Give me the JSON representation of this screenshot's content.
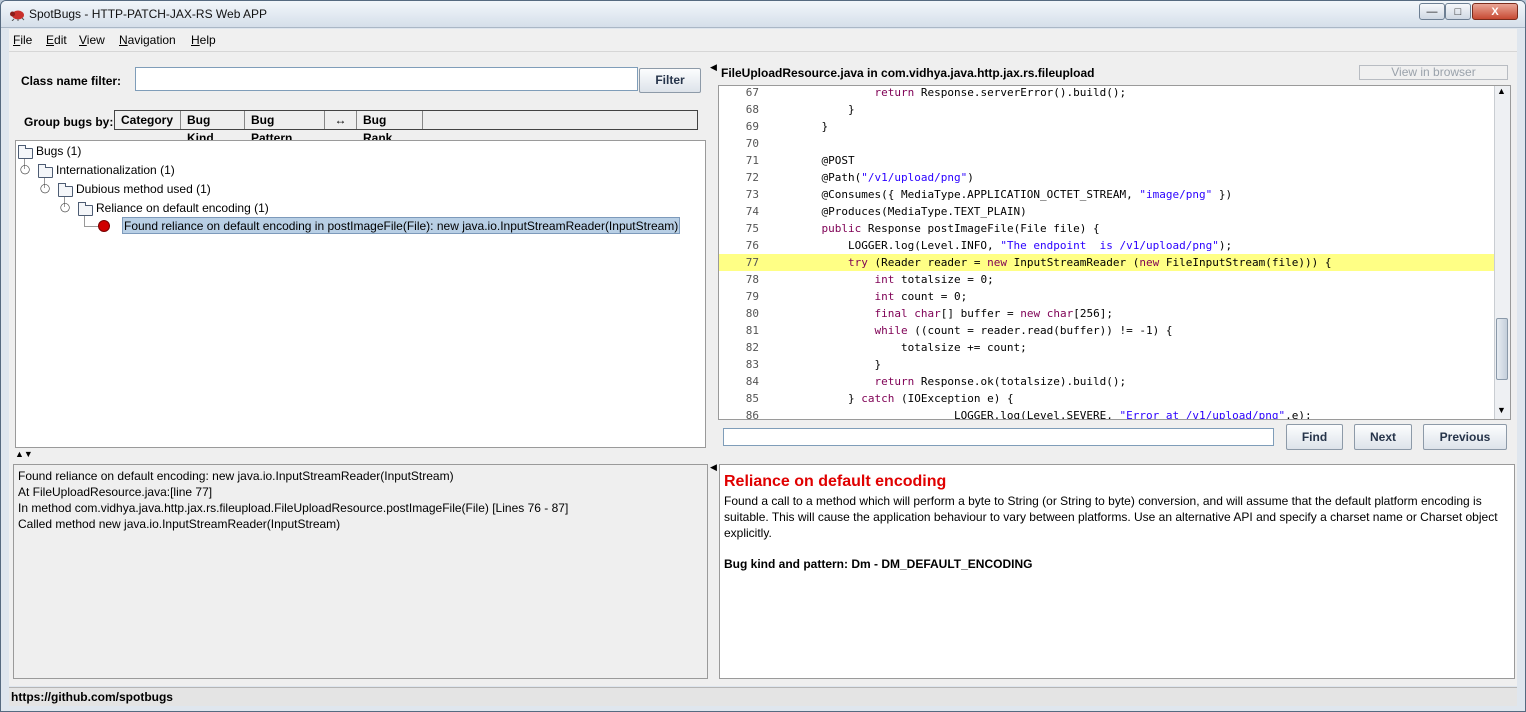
{
  "window": {
    "title": "SpotBugs - HTTP-PATCH-JAX-RS Web APP",
    "controls": {
      "minimize": "—",
      "maximize": "□",
      "close": "X"
    }
  },
  "menu": [
    {
      "first": "F",
      "rest": "ile"
    },
    {
      "first": "E",
      "rest": "dit"
    },
    {
      "first": "V",
      "rest": "iew"
    },
    {
      "first": "N",
      "rest": "avigation"
    },
    {
      "first": "H",
      "rest": "elp"
    }
  ],
  "filter": {
    "label": "Class name filter:",
    "value": "",
    "button": "Filter"
  },
  "group_by": {
    "label": "Group bugs by:",
    "options": [
      "Category",
      "Bug Kind",
      "Bug Pattern",
      "↔",
      "Bug Rank"
    ]
  },
  "tree": [
    {
      "label": "Bugs (1)"
    },
    {
      "label": "Internationalization (1)"
    },
    {
      "label": "Dubious method used (1)"
    },
    {
      "label": "Reliance on default encoding (1)"
    },
    {
      "label": "Found reliance on default encoding in postImageFile(File): new java.io.InputStreamReader(InputStream)"
    }
  ],
  "source": {
    "header": "FileUploadResource.java in com.vidhya.java.http.jax.rs.fileupload",
    "view_in_browser": "View in browser",
    "highlight_line": "77",
    "lines": [
      {
        "n": "67",
        "segs": [
          {
            "t": "            "
          },
          {
            "t": "return",
            "c": "kw"
          },
          {
            "t": " Response.serverError().build();"
          }
        ]
      },
      {
        "n": "68",
        "segs": [
          {
            "t": "        }"
          }
        ]
      },
      {
        "n": "69",
        "segs": [
          {
            "t": "    }"
          }
        ]
      },
      {
        "n": "70",
        "segs": [
          {
            "t": ""
          }
        ]
      },
      {
        "n": "71",
        "segs": [
          {
            "t": "    @POST"
          }
        ]
      },
      {
        "n": "72",
        "segs": [
          {
            "t": "    @Path("
          },
          {
            "t": "\"/v1/upload/png\"",
            "c": "st"
          },
          {
            "t": ")"
          }
        ]
      },
      {
        "n": "73",
        "segs": [
          {
            "t": "    @Consumes({ MediaType.APPLICATION_OCTET_STREAM, "
          },
          {
            "t": "\"image/png\"",
            "c": "st"
          },
          {
            "t": " })"
          }
        ]
      },
      {
        "n": "74",
        "segs": [
          {
            "t": "    @Produces(MediaType.TEXT_PLAIN)"
          }
        ]
      },
      {
        "n": "75",
        "segs": [
          {
            "t": "    "
          },
          {
            "t": "public",
            "c": "kw"
          },
          {
            "t": " Response postImageFile(File file) {"
          }
        ]
      },
      {
        "n": "76",
        "segs": [
          {
            "t": "        LOGGER.log(Level.INFO, "
          },
          {
            "t": "\"The endpoint  is /v1/upload/png\"",
            "c": "st"
          },
          {
            "t": ");"
          }
        ]
      },
      {
        "n": "77",
        "segs": [
          {
            "t": "        "
          },
          {
            "t": "try",
            "c": "kw"
          },
          {
            "t": " (Reader reader = "
          },
          {
            "t": "new",
            "c": "kw"
          },
          {
            "t": " InputStreamReader ("
          },
          {
            "t": "new",
            "c": "kw"
          },
          {
            "t": " FileInputStream(file))) {"
          }
        ]
      },
      {
        "n": "78",
        "segs": [
          {
            "t": "            "
          },
          {
            "t": "int",
            "c": "kw"
          },
          {
            "t": " totalsize = 0;"
          }
        ]
      },
      {
        "n": "79",
        "segs": [
          {
            "t": "            "
          },
          {
            "t": "int",
            "c": "kw"
          },
          {
            "t": " count = 0;"
          }
        ]
      },
      {
        "n": "80",
        "segs": [
          {
            "t": "            "
          },
          {
            "t": "final",
            "c": "kw"
          },
          {
            "t": " "
          },
          {
            "t": "char",
            "c": "kw"
          },
          {
            "t": "[] buffer = "
          },
          {
            "t": "new",
            "c": "kw"
          },
          {
            "t": " "
          },
          {
            "t": "char",
            "c": "kw"
          },
          {
            "t": "[256];"
          }
        ]
      },
      {
        "n": "81",
        "segs": [
          {
            "t": "            "
          },
          {
            "t": "while",
            "c": "kw"
          },
          {
            "t": " ((count = reader.read(buffer)) != -1) {"
          }
        ]
      },
      {
        "n": "82",
        "segs": [
          {
            "t": "                totalsize += count;"
          }
        ]
      },
      {
        "n": "83",
        "segs": [
          {
            "t": "            }"
          }
        ]
      },
      {
        "n": "84",
        "segs": [
          {
            "t": "            "
          },
          {
            "t": "return",
            "c": "kw"
          },
          {
            "t": " Response.ok(totalsize).build();"
          }
        ]
      },
      {
        "n": "85",
        "segs": [
          {
            "t": "        } "
          },
          {
            "t": "catch",
            "c": "kw"
          },
          {
            "t": " (IOException e) {"
          }
        ]
      },
      {
        "n": "86",
        "segs": [
          {
            "t": "                        LOGGER.log(Level.SEVERE, "
          },
          {
            "t": "\"Error at /v1/upload/png\"",
            "c": "st"
          },
          {
            "t": ",e);"
          }
        ]
      }
    ]
  },
  "find": {
    "value": "",
    "find": "Find",
    "next": "Next",
    "previous": "Previous"
  },
  "details": [
    "Found reliance on default encoding: new java.io.InputStreamReader(InputStream)",
    "At FileUploadResource.java:[line 77]",
    "In method com.vidhya.java.http.jax.rs.fileupload.FileUploadResource.postImageFile(File) [Lines 76 - 87]",
    "Called method new java.io.InputStreamReader(InputStream)"
  ],
  "description": {
    "title": "Reliance on default encoding",
    "body": "Found a call to a method which will perform a byte to String (or String to byte) conversion, and will assume that the default platform encoding is suitable. This will cause the application behaviour to vary between platforms. Use an alternative API and specify a charset name or Charset object explicitly.",
    "kind": "Bug kind and pattern: Dm - DM_DEFAULT_ENCODING"
  },
  "status": "https://github.com/spotbugs",
  "colors": {
    "highlight": "#ffff85",
    "keyword": "#7f0055",
    "string": "#2a00ff",
    "desc_title": "#e00000",
    "bug_dot": "#d00000"
  },
  "icons": [
    "app-bug-icon",
    "folder-icon",
    "bug-icon",
    "expand-knob-icon",
    "split-arrows-icon"
  ]
}
